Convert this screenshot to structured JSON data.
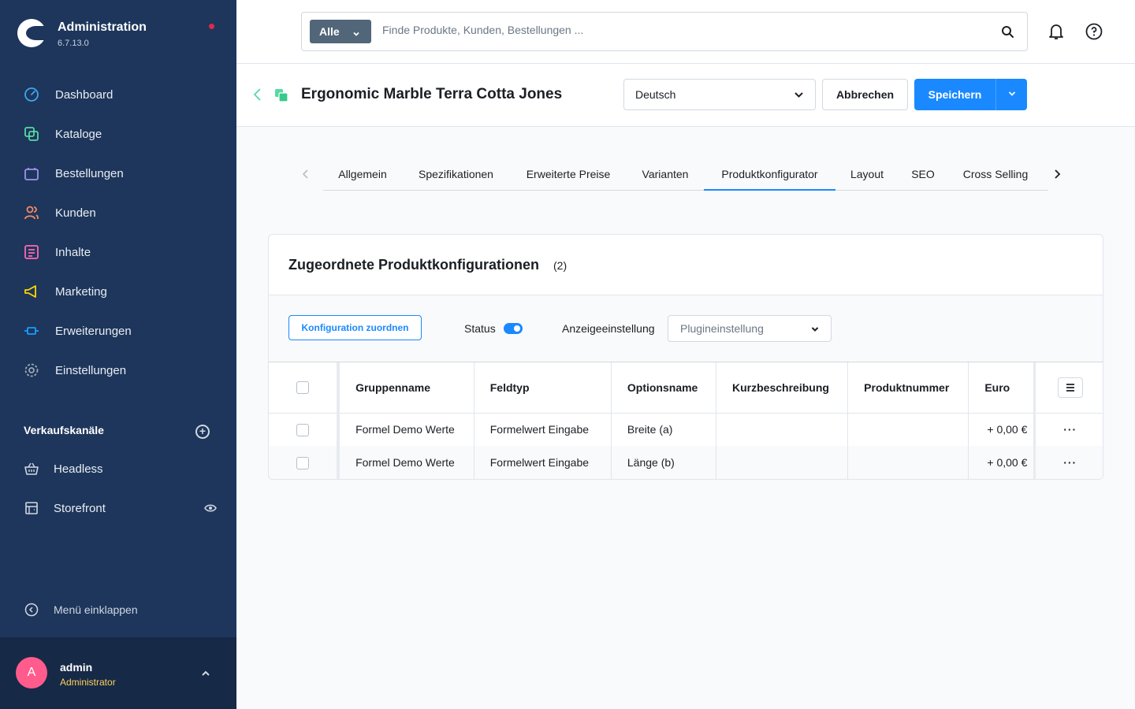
{
  "app": {
    "title": "Administration",
    "version": "6.7.13.0"
  },
  "sidebar": {
    "items": [
      {
        "label": "Dashboard",
        "icon": "dashboard-icon",
        "color": "#3aa8f2"
      },
      {
        "label": "Kataloge",
        "icon": "catalog-icon",
        "color": "#57d9a3"
      },
      {
        "label": "Bestellungen",
        "icon": "bag-icon",
        "color": "#a092f0"
      },
      {
        "label": "Kunden",
        "icon": "users-icon",
        "color": "#f88962"
      },
      {
        "label": "Inhalte",
        "icon": "content-icon",
        "color": "#ff68b4"
      },
      {
        "label": "Marketing",
        "icon": "megaphone-icon",
        "color": "#ffd700"
      },
      {
        "label": "Erweiterungen",
        "icon": "plug-icon",
        "color": "#189eff"
      },
      {
        "label": "Einstellungen",
        "icon": "gear-icon",
        "color": "#9aa8b5"
      }
    ],
    "sales_channels_title": "Verkaufskanäle",
    "channels": [
      {
        "label": "Headless",
        "icon": "basket-icon"
      },
      {
        "label": "Storefront",
        "icon": "storefront-icon"
      }
    ],
    "collapse_label": "Menü einklappen",
    "user": {
      "initial": "A",
      "name": "admin",
      "role": "Administrator"
    }
  },
  "search": {
    "type": "Alle",
    "placeholder": "Finde Produkte, Kunden, Bestellungen ..."
  },
  "smartbar": {
    "title": "Ergonomic Marble Terra Cotta Jones",
    "language": "Deutsch",
    "cancel": "Abbrechen",
    "save": "Speichern"
  },
  "tabs": [
    {
      "label": "Allgemein"
    },
    {
      "label": "Spezifikationen"
    },
    {
      "label": "Erweiterte Preise"
    },
    {
      "label": "Varianten"
    },
    {
      "label": "Produktkonfigurator",
      "active": true
    },
    {
      "label": "Layout"
    },
    {
      "label": "SEO"
    },
    {
      "label": "Cross Selling"
    }
  ],
  "card": {
    "title": "Zugeordnete Produktkonfigurationen",
    "count": "(2)",
    "assign_button": "Konfiguration zuordnen",
    "status_label": "Status",
    "status_on": true,
    "display_label": "Anzeigeeinstellung",
    "display_placeholder": "Plugineinstellung",
    "columns": [
      "Gruppenname",
      "Feldtyp",
      "Optionsname",
      "Kurzbeschreibung",
      "Produktnummer",
      "Euro"
    ],
    "rows": [
      {
        "group": "Formel Demo Werte",
        "type": "Formelwert Eingabe",
        "option": "Breite (a)",
        "short": "",
        "number": "",
        "price": "+ 0,00 €"
      },
      {
        "group": "Formel Demo Werte",
        "type": "Formelwert Eingabe",
        "option": "Länge (b)",
        "short": "",
        "number": "",
        "price": "+ 0,00 €"
      }
    ]
  },
  "colors": {
    "sidebar": "#1e365b",
    "accent": "#1a89ff",
    "avatar": "#ff5c8d",
    "role": "#ffd15b"
  }
}
